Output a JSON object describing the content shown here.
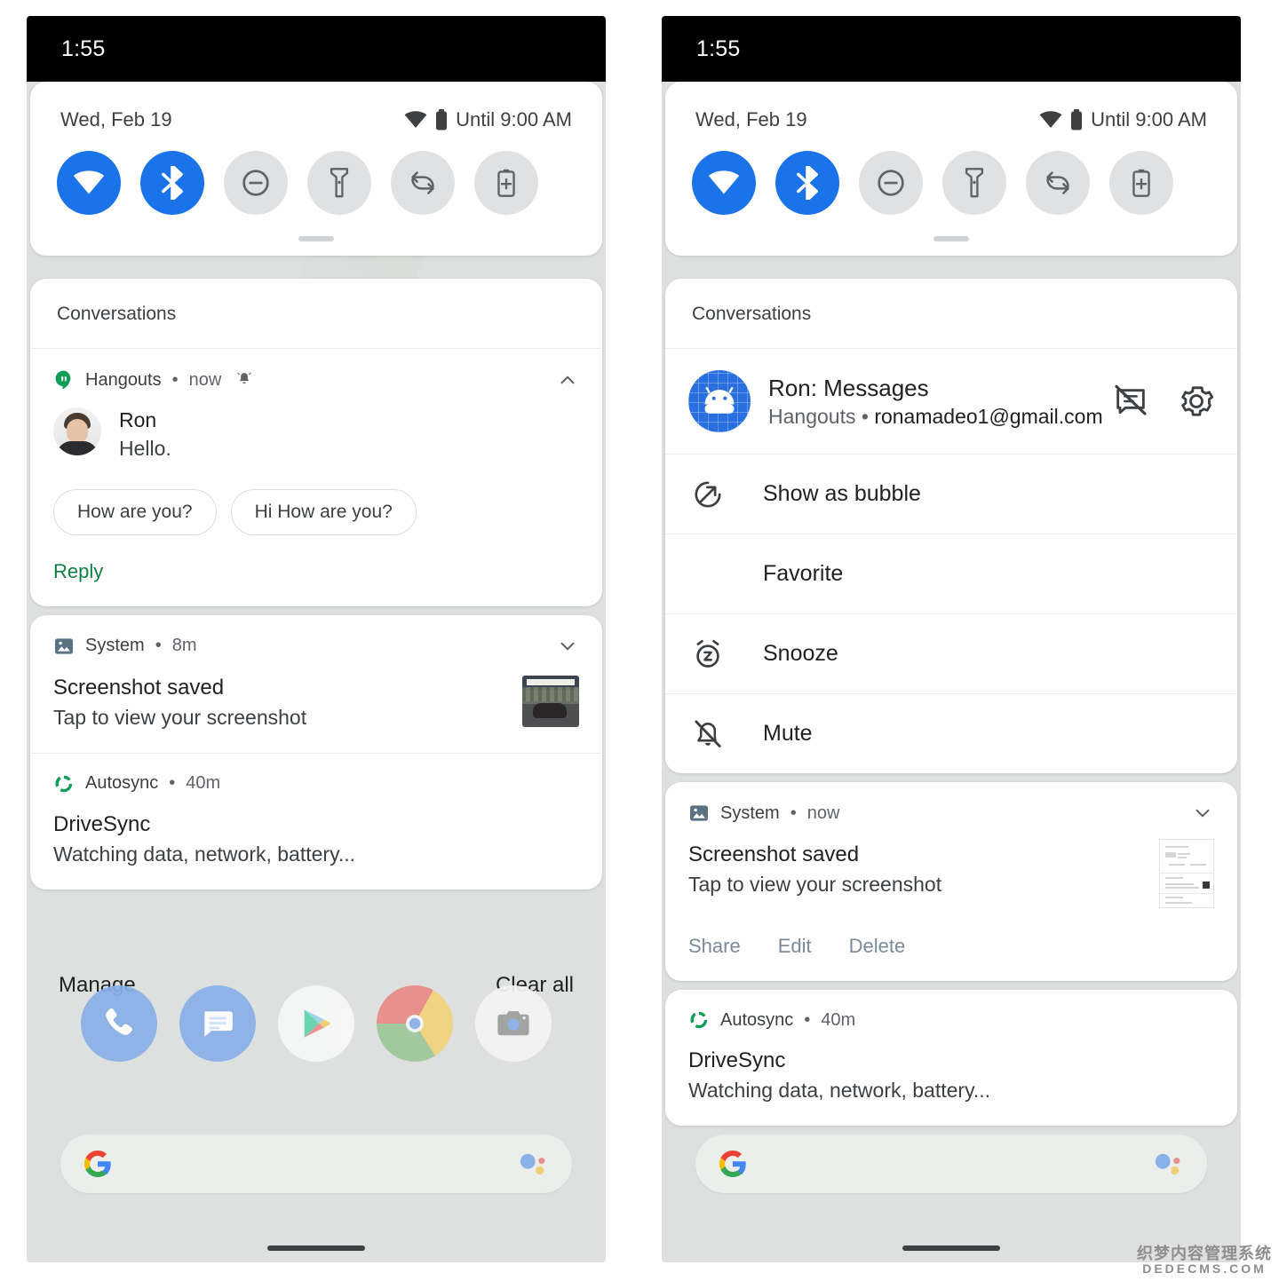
{
  "statusbar": {
    "time": "1:55"
  },
  "quick_settings": {
    "date": "Wed, Feb 19",
    "battery_status": "Until 9:00 AM",
    "tiles": [
      {
        "name": "wifi",
        "label": "Wi-Fi",
        "state": "on"
      },
      {
        "name": "bluetooth",
        "label": "Bluetooth",
        "state": "on"
      },
      {
        "name": "do-not-disturb",
        "label": "Do Not Disturb",
        "state": "off"
      },
      {
        "name": "flashlight",
        "label": "Flashlight",
        "state": "off"
      },
      {
        "name": "auto-rotate",
        "label": "Auto-rotate",
        "state": "off"
      },
      {
        "name": "battery-saver",
        "label": "Battery Saver",
        "state": "off"
      }
    ],
    "accent_on": "#1a73e8",
    "tile_off_bg": "#dfe1e3"
  },
  "left_phone": {
    "section_header": "Conversations",
    "conversation": {
      "app": "Hangouts",
      "separator": "•",
      "time": "now",
      "alert_icon": "bell-ringing-icon",
      "collapse_icon": "chevron-up-icon",
      "sender": "Ron",
      "message": "Hello.",
      "smart_replies": [
        "How are you?",
        "Hi How are you?"
      ],
      "reply_label": "Reply",
      "reply_color": "#0f8043"
    },
    "screenshot_notification": {
      "app": "System",
      "separator": "•",
      "time": "8m",
      "expand_icon": "chevron-down-icon",
      "title": "Screenshot saved",
      "body": "Tap to view your screenshot"
    },
    "autosync_notification": {
      "app": "Autosync",
      "separator": "•",
      "time": "40m",
      "title": "DriveSync",
      "body": "Watching data, network, battery..."
    },
    "footer": {
      "manage": "Manage",
      "clear_all": "Clear all"
    }
  },
  "right_phone": {
    "section_header": "Conversations",
    "conversation_menu": {
      "title": "Ron: Messages",
      "app": "Hangouts",
      "separator": "•",
      "account": "ronamadeo1@gmail.com",
      "header_icons": [
        "conversation-off-icon",
        "gear-icon"
      ],
      "items": [
        {
          "label": "Show as bubble",
          "icon": "bubble-icon"
        },
        {
          "label": "Favorite",
          "icon": "none"
        },
        {
          "label": "Snooze",
          "icon": "snooze-icon"
        },
        {
          "label": "Mute",
          "icon": "bell-off-icon"
        }
      ]
    },
    "screenshot_notification": {
      "app": "System",
      "separator": "•",
      "time": "now",
      "expand_icon": "chevron-down-icon",
      "title": "Screenshot saved",
      "body": "Tap to view your screenshot",
      "actions": [
        "Share",
        "Edit",
        "Delete"
      ],
      "action_color": "#7b8a99"
    },
    "autosync_notification": {
      "app": "Autosync",
      "separator": "•",
      "time": "40m",
      "title": "DriveSync",
      "body": "Watching data, network, battery..."
    }
  },
  "dock": {
    "apps": [
      {
        "name": "phone",
        "icon": "phone-icon"
      },
      {
        "name": "messages",
        "icon": "messages-icon"
      },
      {
        "name": "play-store",
        "icon": "play-store-icon"
      },
      {
        "name": "chrome",
        "icon": "chrome-icon"
      },
      {
        "name": "camera",
        "icon": "camera-icon"
      }
    ],
    "search_placeholder": ""
  },
  "watermark": {
    "line1": "织梦内容管理系统",
    "line2": "DEDECMS.COM"
  }
}
